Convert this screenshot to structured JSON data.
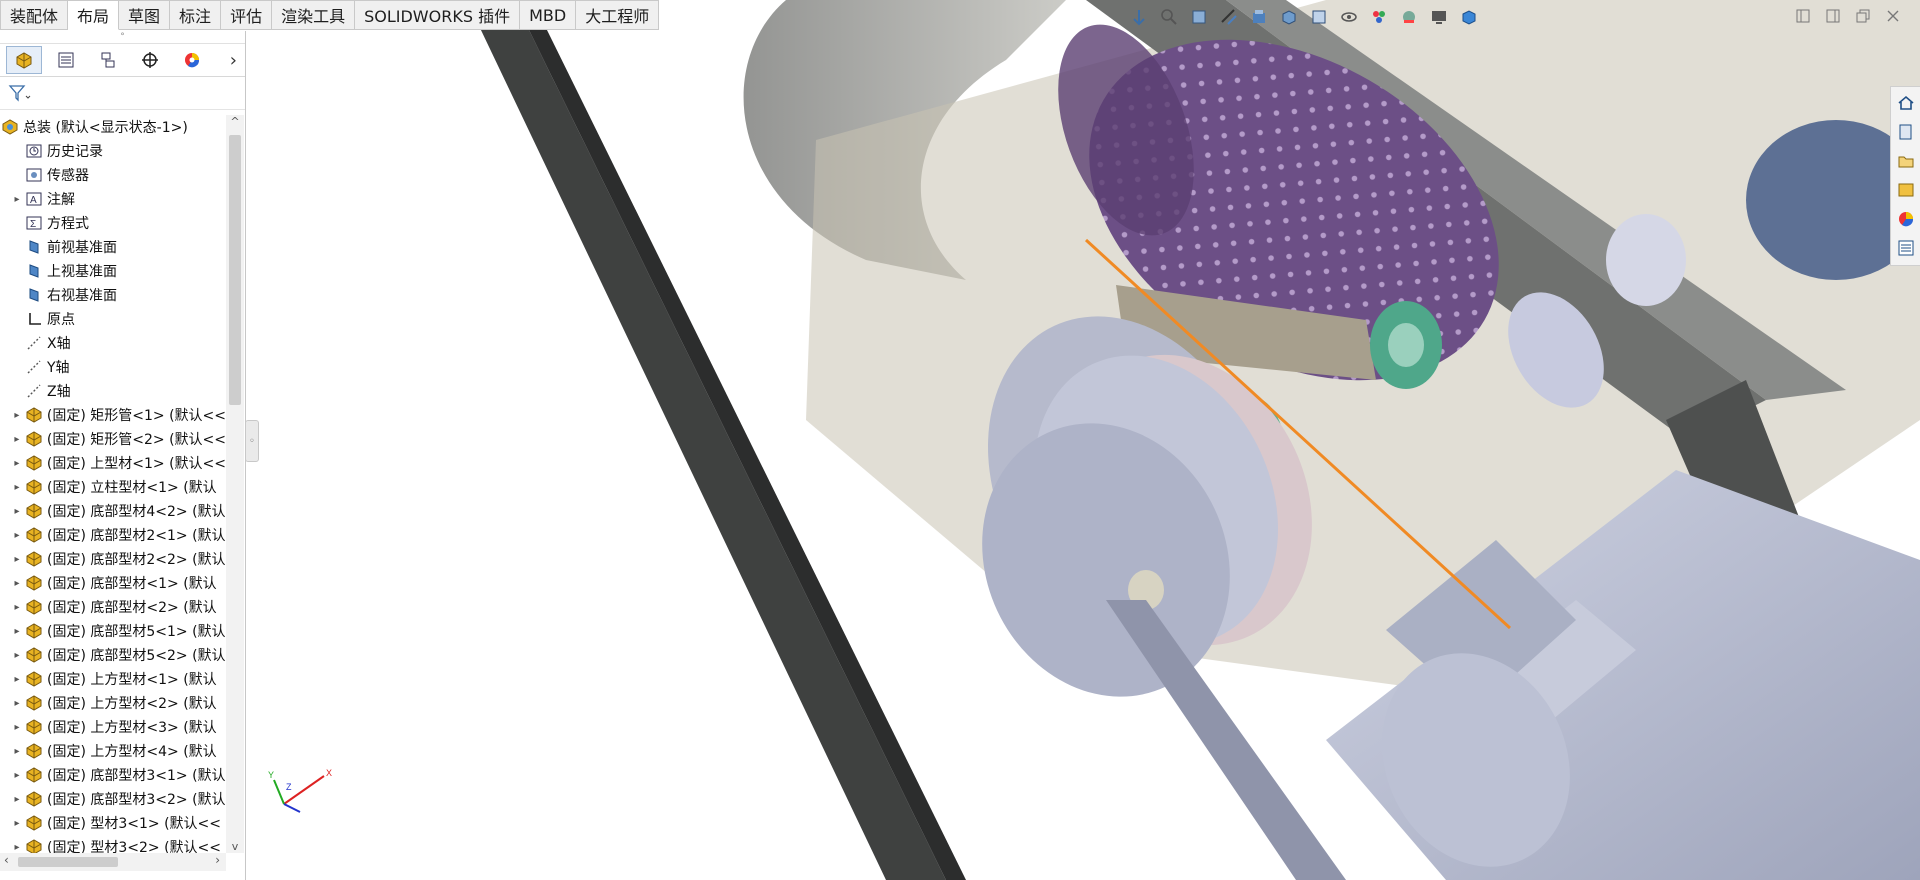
{
  "tabs": [
    {
      "label": "装配体",
      "active": false
    },
    {
      "label": "布局",
      "active": true
    },
    {
      "label": "草图",
      "active": false
    },
    {
      "label": "标注",
      "active": false
    },
    {
      "label": "评估",
      "active": false
    },
    {
      "label": "渲染工具",
      "active": false
    },
    {
      "label": "SOLIDWORKS 插件",
      "active": false
    },
    {
      "label": "MBD",
      "active": false
    },
    {
      "label": "大工程师",
      "active": false
    }
  ],
  "panel_tabs": [
    "featuremanager-tab",
    "propertymanager-tab",
    "configurationmanager-tab",
    "dimxpert-tab",
    "display-manager-tab"
  ],
  "tree": {
    "root": "总装  (默认<显示状态-1>)",
    "items": [
      {
        "label": "历史记录",
        "icon": "history-icon",
        "expand": false
      },
      {
        "label": "传感器",
        "icon": "sensor-icon",
        "expand": false
      },
      {
        "label": "注解",
        "icon": "annotation-icon",
        "expand": true
      },
      {
        "label": "方程式",
        "icon": "equation-icon",
        "expand": false
      },
      {
        "label": "前视基准面",
        "icon": "plane-icon",
        "expand": false
      },
      {
        "label": "上视基准面",
        "icon": "plane-icon",
        "expand": false
      },
      {
        "label": "右视基准面",
        "icon": "plane-icon",
        "expand": false
      },
      {
        "label": "原点",
        "icon": "origin-icon",
        "expand": false
      },
      {
        "label": "X轴",
        "icon": "axis-icon",
        "expand": false
      },
      {
        "label": "Y轴",
        "icon": "axis-icon",
        "expand": false
      },
      {
        "label": "Z轴",
        "icon": "axis-icon",
        "expand": false
      },
      {
        "label": "(固定) 矩形管<1> (默认<<",
        "icon": "part-icon",
        "expand": true
      },
      {
        "label": "(固定) 矩形管<2> (默认<<",
        "icon": "part-icon",
        "expand": true
      },
      {
        "label": "(固定) 上型材<1> (默认<<",
        "icon": "part-icon",
        "expand": true
      },
      {
        "label": "(固定) 立柱型材<1> (默认",
        "icon": "part-icon",
        "expand": true
      },
      {
        "label": "(固定) 底部型材4<2> (默认",
        "icon": "part-icon",
        "expand": true
      },
      {
        "label": "(固定) 底部型材2<1> (默认",
        "icon": "part-icon",
        "expand": true
      },
      {
        "label": "(固定) 底部型材2<2> (默认",
        "icon": "part-icon",
        "expand": true
      },
      {
        "label": "(固定) 底部型材<1> (默认",
        "icon": "part-icon",
        "expand": true
      },
      {
        "label": "(固定) 底部型材<2> (默认",
        "icon": "part-icon",
        "expand": true
      },
      {
        "label": "(固定) 底部型材5<1> (默认",
        "icon": "part-icon",
        "expand": true
      },
      {
        "label": "(固定) 底部型材5<2> (默认",
        "icon": "part-icon",
        "expand": true
      },
      {
        "label": "(固定) 上方型材<1> (默认",
        "icon": "part-icon",
        "expand": true
      },
      {
        "label": "(固定) 上方型材<2> (默认",
        "icon": "part-icon",
        "expand": true
      },
      {
        "label": "(固定) 上方型材<3> (默认",
        "icon": "part-icon",
        "expand": true
      },
      {
        "label": "(固定) 上方型材<4> (默认",
        "icon": "part-icon",
        "expand": true
      },
      {
        "label": "(固定) 底部型材3<1> (默认",
        "icon": "part-icon",
        "expand": true
      },
      {
        "label": "(固定) 底部型材3<2> (默认",
        "icon": "part-icon",
        "expand": true
      },
      {
        "label": "(固定) 型材3<1> (默认<<",
        "icon": "part-icon",
        "expand": true
      },
      {
        "label": "(固定) 型材3<2> (默认<<",
        "icon": "part-icon",
        "expand": true
      }
    ]
  },
  "triad": {
    "x": "X",
    "y": "Y",
    "z": "Z"
  },
  "colors": {
    "tab_bg": "#f0f0f0",
    "frame_dark": "#4a4c4b",
    "drum_purple": "#6e4f86",
    "motor_blue_gray": "#b9bed3",
    "sketch_line_orange": "#f08a24",
    "shaft_bearing_green": "#4fa78a"
  }
}
